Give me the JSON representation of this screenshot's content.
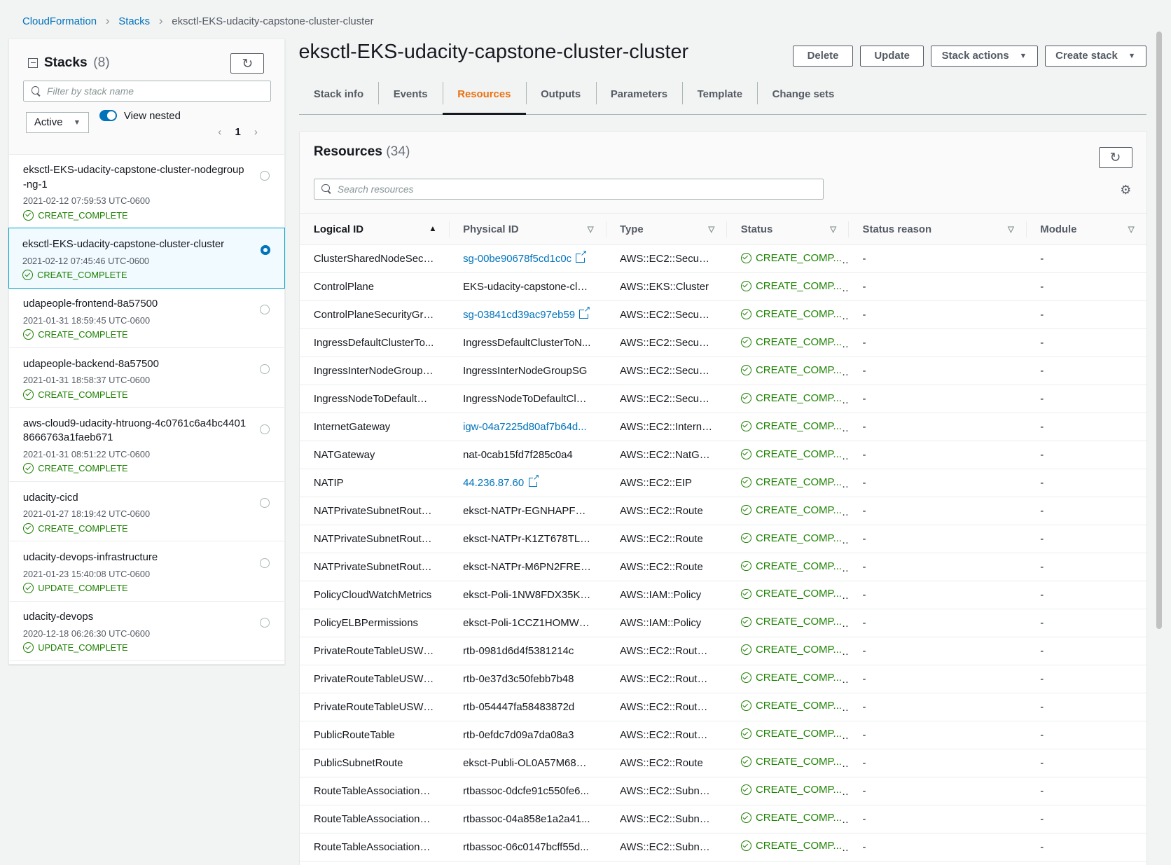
{
  "breadcrumb": {
    "items": [
      "CloudFormation",
      "Stacks"
    ],
    "current": "eksctl-EKS-udacity-capstone-cluster-cluster"
  },
  "sidebar": {
    "title": "Stacks",
    "count": "(8)",
    "filter_placeholder": "Filter by stack name",
    "filter_select": "Active",
    "view_nested": "View nested",
    "page": "1",
    "stacks": [
      {
        "name": "eksctl-EKS-udacity-capstone-cluster-nodegroup-ng-1",
        "date": "2021-02-12 07:59:53 UTC-0600",
        "status": "CREATE_COMPLETE",
        "selected": false
      },
      {
        "name": "eksctl-EKS-udacity-capstone-cluster-cluster",
        "date": "2021-02-12 07:45:46 UTC-0600",
        "status": "CREATE_COMPLETE",
        "selected": true
      },
      {
        "name": "udapeople-frontend-8a57500",
        "date": "2021-01-31 18:59:45 UTC-0600",
        "status": "CREATE_COMPLETE",
        "selected": false
      },
      {
        "name": "udapeople-backend-8a57500",
        "date": "2021-01-31 18:58:37 UTC-0600",
        "status": "CREATE_COMPLETE",
        "selected": false
      },
      {
        "name": "aws-cloud9-udacity-htruong-4c0761c6a4bc44018666763a1faeb671",
        "date": "2021-01-31 08:51:22 UTC-0600",
        "status": "CREATE_COMPLETE",
        "selected": false
      },
      {
        "name": "udacity-cicd",
        "date": "2021-01-27 18:19:42 UTC-0600",
        "status": "CREATE_COMPLETE",
        "selected": false
      },
      {
        "name": "udacity-devops-infrastructure",
        "date": "2021-01-23 15:40:08 UTC-0600",
        "status": "UPDATE_COMPLETE",
        "selected": false
      },
      {
        "name": "udacity-devops",
        "date": "2020-12-18 06:26:30 UTC-0600",
        "status": "UPDATE_COMPLETE",
        "selected": false
      }
    ]
  },
  "header": {
    "title": "eksctl-EKS-udacity-capstone-cluster-cluster",
    "buttons": {
      "delete": "Delete",
      "update": "Update",
      "stack_actions": "Stack actions",
      "create_stack": "Create stack"
    }
  },
  "tabs": [
    {
      "label": "Stack info",
      "active": false
    },
    {
      "label": "Events",
      "active": false
    },
    {
      "label": "Resources",
      "active": true
    },
    {
      "label": "Outputs",
      "active": false
    },
    {
      "label": "Parameters",
      "active": false
    },
    {
      "label": "Template",
      "active": false
    },
    {
      "label": "Change sets",
      "active": false
    }
  ],
  "resources": {
    "title": "Resources",
    "count": "(34)",
    "search_placeholder": "Search resources",
    "columns": [
      "Logical ID",
      "Physical ID",
      "Type",
      "Status",
      "Status reason",
      "Module"
    ],
    "rows": [
      {
        "logical": "ClusterSharedNodeSecur...",
        "physical": "sg-00be90678f5cd1c0c",
        "link": true,
        "ext": true,
        "type": "AWS::EC2::Security...",
        "status": "CREATE_COMP...",
        "reason": "-",
        "module": "-"
      },
      {
        "logical": "ControlPlane",
        "physical": "EKS-udacity-capstone-clu...",
        "link": false,
        "ext": false,
        "type": "AWS::EKS::Cluster",
        "status": "CREATE_COMP...",
        "reason": "-",
        "module": "-"
      },
      {
        "logical": "ControlPlaneSecurityGro...",
        "physical": "sg-03841cd39ac97eb59",
        "link": true,
        "ext": true,
        "type": "AWS::EC2::Security...",
        "status": "CREATE_COMP...",
        "reason": "-",
        "module": "-"
      },
      {
        "logical": "IngressDefaultClusterTo...",
        "physical": "IngressDefaultClusterToN...",
        "link": false,
        "ext": false,
        "type": "AWS::EC2::Security...",
        "status": "CREATE_COMP...",
        "reason": "-",
        "module": "-"
      },
      {
        "logical": "IngressInterNodeGroupSG",
        "physical": "IngressInterNodeGroupSG",
        "link": false,
        "ext": false,
        "type": "AWS::EC2::Security...",
        "status": "CREATE_COMP...",
        "reason": "-",
        "module": "-"
      },
      {
        "logical": "IngressNodeToDefaultCl...",
        "physical": "IngressNodeToDefaultClus...",
        "link": false,
        "ext": false,
        "type": "AWS::EC2::Security...",
        "status": "CREATE_COMP...",
        "reason": "-",
        "module": "-"
      },
      {
        "logical": "InternetGateway",
        "physical": "igw-04a7225d80af7b64d...",
        "link": true,
        "ext": false,
        "type": "AWS::EC2::Internet...",
        "status": "CREATE_COMP...",
        "reason": "-",
        "module": "-"
      },
      {
        "logical": "NATGateway",
        "physical": "nat-0cab15fd7f285c0a4",
        "link": false,
        "ext": false,
        "type": "AWS::EC2::NatGat...",
        "status": "CREATE_COMP...",
        "reason": "-",
        "module": "-"
      },
      {
        "logical": "NATIP",
        "physical": "44.236.87.60",
        "link": true,
        "ext": true,
        "type": "AWS::EC2::EIP",
        "status": "CREATE_COMP...",
        "reason": "-",
        "module": "-"
      },
      {
        "logical": "NATPrivateSubnetRoute...",
        "physical": "eksct-NATPr-EGNHAPFLN...",
        "link": false,
        "ext": false,
        "type": "AWS::EC2::Route",
        "status": "CREATE_COMP...",
        "reason": "-",
        "module": "-"
      },
      {
        "logical": "NATPrivateSubnetRoute...",
        "physical": "eksct-NATPr-K1ZT678TLJ5D",
        "link": false,
        "ext": false,
        "type": "AWS::EC2::Route",
        "status": "CREATE_COMP...",
        "reason": "-",
        "module": "-"
      },
      {
        "logical": "NATPrivateSubnetRoute...",
        "physical": "eksct-NATPr-M6PN2FRELC...",
        "link": false,
        "ext": false,
        "type": "AWS::EC2::Route",
        "status": "CREATE_COMP...",
        "reason": "-",
        "module": "-"
      },
      {
        "logical": "PolicyCloudWatchMetrics",
        "physical": "eksct-Poli-1NW8FDX35KIFN",
        "link": false,
        "ext": false,
        "type": "AWS::IAM::Policy",
        "status": "CREATE_COMP...",
        "reason": "-",
        "module": "-"
      },
      {
        "logical": "PolicyELBPermissions",
        "physical": "eksct-Poli-1CCZ1HOMWR...",
        "link": false,
        "ext": false,
        "type": "AWS::IAM::Policy",
        "status": "CREATE_COMP...",
        "reason": "-",
        "module": "-"
      },
      {
        "logical": "PrivateRouteTableUSWE...",
        "physical": "rtb-0981d6d4f5381214c",
        "link": false,
        "ext": false,
        "type": "AWS::EC2::RouteT...",
        "status": "CREATE_COMP...",
        "reason": "-",
        "module": "-"
      },
      {
        "logical": "PrivateRouteTableUSWE...",
        "physical": "rtb-0e37d3c50febb7b48",
        "link": false,
        "ext": false,
        "type": "AWS::EC2::RouteT...",
        "status": "CREATE_COMP...",
        "reason": "-",
        "module": "-"
      },
      {
        "logical": "PrivateRouteTableUSWE...",
        "physical": "rtb-054447fa58483872d",
        "link": false,
        "ext": false,
        "type": "AWS::EC2::RouteT...",
        "status": "CREATE_COMP...",
        "reason": "-",
        "module": "-"
      },
      {
        "logical": "PublicRouteTable",
        "physical": "rtb-0efdc7d09a7da08a3",
        "link": false,
        "ext": false,
        "type": "AWS::EC2::RouteT...",
        "status": "CREATE_COMP...",
        "reason": "-",
        "module": "-"
      },
      {
        "logical": "PublicSubnetRoute",
        "physical": "eksct-Publi-OL0A57M68W...",
        "link": false,
        "ext": false,
        "type": "AWS::EC2::Route",
        "status": "CREATE_COMP...",
        "reason": "-",
        "module": "-"
      },
      {
        "logical": "RouteTableAssociationPr...",
        "physical": "rtbassoc-0dcfe91c550fe6...",
        "link": false,
        "ext": false,
        "type": "AWS::EC2::Subnet...",
        "status": "CREATE_COMP...",
        "reason": "-",
        "module": "-"
      },
      {
        "logical": "RouteTableAssociationPr...",
        "physical": "rtbassoc-04a858e1a2a41...",
        "link": false,
        "ext": false,
        "type": "AWS::EC2::Subnet...",
        "status": "CREATE_COMP...",
        "reason": "-",
        "module": "-"
      },
      {
        "logical": "RouteTableAssociationPr...",
        "physical": "rtbassoc-06c0147bcff55d...",
        "link": false,
        "ext": false,
        "type": "AWS::EC2::Subnet...",
        "status": "CREATE_COMP...",
        "reason": "-",
        "module": "-"
      }
    ]
  }
}
